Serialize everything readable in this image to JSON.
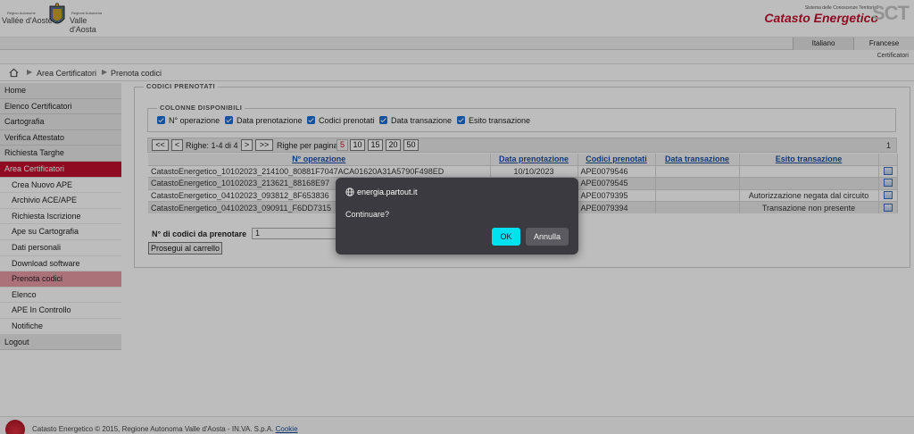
{
  "header": {
    "logo_small_1": "Région Autonome",
    "logo_big_1": "Vallée d'Aoste",
    "logo_small_2": "Regione Autonoma",
    "logo_big_2": "Valle d'Aosta",
    "system_label": "Sistema delle Conoscenze Territoriali",
    "brand": "Catasto Energetico",
    "brand_mark": "SCT"
  },
  "languages": [
    "Italiano",
    "Francese"
  ],
  "role": "Certificatori",
  "breadcrumb": [
    "Area Certificatori",
    "Prenota codici"
  ],
  "sidebar": [
    {
      "label": "Home",
      "type": "top"
    },
    {
      "label": "Elenco Certificatori",
      "type": "top"
    },
    {
      "label": "Cartografia",
      "type": "top"
    },
    {
      "label": "Verifica Attestato",
      "type": "top"
    },
    {
      "label": "Richiesta Targhe",
      "type": "top"
    },
    {
      "label": "Area Certificatori",
      "type": "active"
    },
    {
      "label": "Crea Nuovo APE",
      "type": "sub"
    },
    {
      "label": "Archivio ACE/APE",
      "type": "sub"
    },
    {
      "label": "Richiesta Iscrizione",
      "type": "sub"
    },
    {
      "label": "Ape su Cartografia",
      "type": "sub"
    },
    {
      "label": "Dati personali",
      "type": "sub"
    },
    {
      "label": "Download software",
      "type": "sub"
    },
    {
      "label": "Prenota codici",
      "type": "selected"
    },
    {
      "label": "Elenco",
      "type": "sub"
    },
    {
      "label": "APE In Controllo",
      "type": "sub"
    },
    {
      "label": "Notifiche",
      "type": "sub"
    },
    {
      "label": "Logout",
      "type": "top"
    }
  ],
  "main": {
    "legend": "Codici prenotati",
    "columns_legend": "Colonne disponibili",
    "columns": [
      "N° operazione",
      "Data prenotazione",
      "Codici prenotati",
      "Data transazione",
      "Esito transazione"
    ],
    "pager": {
      "first": "<<",
      "prev": "<",
      "rows_info": "Righe: 1-4 di 4",
      "next": ">",
      "last": ">>",
      "per_page_label": "Righe per pagina",
      "sizes": [
        "5",
        "10",
        "15",
        "20",
        "50"
      ],
      "active_size": "5",
      "page_count": "1"
    },
    "table": {
      "headers": [
        "N° operazione",
        "Data prenotazione",
        "Codici prenotati",
        "Data transazione",
        "Esito transazione",
        ""
      ],
      "rows": [
        [
          "CatastoEnergetico_10102023_214100_80881F7047ACA01620A31A5790F498ED",
          "10/10/2023",
          "APE0079546",
          "",
          ""
        ],
        [
          "CatastoEnergetico_10102023_213621_88168E97",
          "",
          "APE0079545",
          "",
          ""
        ],
        [
          "CatastoEnergetico_04102023_093812_8F653836",
          "",
          "APE0079395",
          "",
          "Autorizzazione negata dal circuito"
        ],
        [
          "CatastoEnergetico_04102023_090911_F6DD7315",
          "",
          "APE0079394",
          "",
          "Transazione non presente"
        ]
      ]
    },
    "qty_label": "N° di codici da prenotare",
    "qty_value": "1",
    "cart_button": "Prosegui al carrello"
  },
  "footer": {
    "text": "Catasto Energetico © 2015, Regione Autonoma Valle d'Aosta - IN.VA. S.p.A.",
    "link": "Cookie"
  },
  "dialog": {
    "origin": "energia.partout.it",
    "message": "Continuare?",
    "ok": "OK",
    "cancel": "Annulla"
  },
  "colors": {
    "brand_red": "#c0102e",
    "selected_pink": "#e89aa4",
    "dialog_bg": "#3a3a40",
    "ok_button": "#00e1f0",
    "checkbox_blue": "#1b6fd1"
  }
}
